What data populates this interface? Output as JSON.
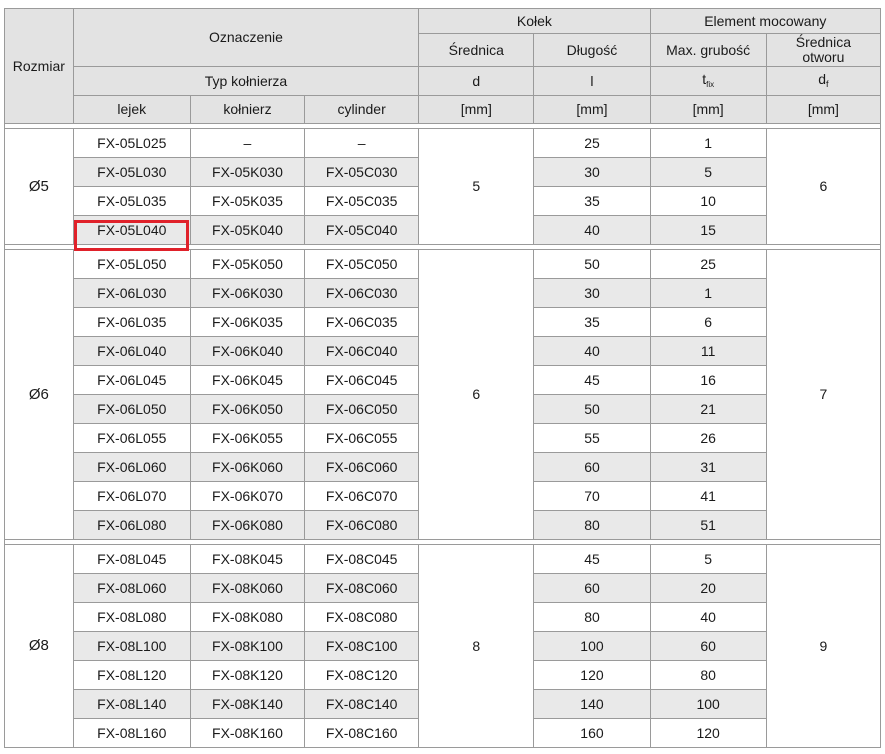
{
  "header": {
    "rozmiar": "Rozmiar",
    "oznaczenie": "Oznaczenie",
    "kolek": "Kołek",
    "element": "Element mocowany",
    "srednica": "Średnica",
    "dlugosc": "Długość",
    "max_grubosc": "Max. grubość",
    "srednica_otworu_1": "Średnica",
    "srednica_otworu_2": "otworu",
    "typ_kolnierza": "Typ kołnierza",
    "sym_d": "d",
    "sym_l": "l",
    "sym_t": "t",
    "sym_t_sub": "fix",
    "sym_df": "d",
    "sym_df_sub": "f",
    "col_lejek": "lejek",
    "col_kolnierz": "kołnierz",
    "col_cylinder": "cylinder",
    "unit_mm": "[mm]"
  },
  "groups": [
    {
      "size": "Ø5",
      "d": "5",
      "df": "6",
      "rows": [
        {
          "l": "FX-05L025",
          "k": "–",
          "c": "–",
          "len": "25",
          "t": "1"
        },
        {
          "l": "FX-05L030",
          "k": "FX-05K030",
          "c": "FX-05C030",
          "len": "30",
          "t": "5"
        },
        {
          "l": "FX-05L035",
          "k": "FX-05K035",
          "c": "FX-05C035",
          "len": "35",
          "t": "10"
        },
        {
          "l": "FX-05L040",
          "k": "FX-05K040",
          "c": "FX-05C040",
          "len": "40",
          "t": "15"
        }
      ]
    },
    {
      "size": "Ø6",
      "d": "6",
      "df": "7",
      "rows": [
        {
          "l": "FX-05L050",
          "k": "FX-05K050",
          "c": "FX-05C050",
          "len": "50",
          "t": "25"
        },
        {
          "l": "FX-06L030",
          "k": "FX-06K030",
          "c": "FX-06C030",
          "len": "30",
          "t": "1"
        },
        {
          "l": "FX-06L035",
          "k": "FX-06K035",
          "c": "FX-06C035",
          "len": "35",
          "t": "6"
        },
        {
          "l": "FX-06L040",
          "k": "FX-06K040",
          "c": "FX-06C040",
          "len": "40",
          "t": "11"
        },
        {
          "l": "FX-06L045",
          "k": "FX-06K045",
          "c": "FX-06C045",
          "len": "45",
          "t": "16"
        },
        {
          "l": "FX-06L050",
          "k": "FX-06K050",
          "c": "FX-06C050",
          "len": "50",
          "t": "21"
        },
        {
          "l": "FX-06L055",
          "k": "FX-06K055",
          "c": "FX-06C055",
          "len": "55",
          "t": "26"
        },
        {
          "l": "FX-06L060",
          "k": "FX-06K060",
          "c": "FX-06C060",
          "len": "60",
          "t": "31"
        },
        {
          "l": "FX-06L070",
          "k": "FX-06K070",
          "c": "FX-06C070",
          "len": "70",
          "t": "41"
        },
        {
          "l": "FX-06L080",
          "k": "FX-06K080",
          "c": "FX-06C080",
          "len": "80",
          "t": "51"
        }
      ]
    },
    {
      "size": "Ø8",
      "d": "8",
      "df": "9",
      "rows": [
        {
          "l": "FX-08L045",
          "k": "FX-08K045",
          "c": "FX-08C045",
          "len": "45",
          "t": "5"
        },
        {
          "l": "FX-08L060",
          "k": "FX-08K060",
          "c": "FX-08C060",
          "len": "60",
          "t": "20"
        },
        {
          "l": "FX-08L080",
          "k": "FX-08K080",
          "c": "FX-08C080",
          "len": "80",
          "t": "40"
        },
        {
          "l": "FX-08L100",
          "k": "FX-08K100",
          "c": "FX-08C100",
          "len": "100",
          "t": "60"
        },
        {
          "l": "FX-08L120",
          "k": "FX-08K120",
          "c": "FX-08C120",
          "len": "120",
          "t": "80"
        },
        {
          "l": "FX-08L140",
          "k": "FX-08K140",
          "c": "FX-08C140",
          "len": "140",
          "t": "100"
        },
        {
          "l": "FX-08L160",
          "k": "FX-08K160",
          "c": "FX-08C160",
          "len": "160",
          "t": "120"
        }
      ]
    }
  ],
  "colors": {
    "header_bg": "#e3e3e3",
    "stripe_bg": "#e9e9e9",
    "highlight": "#e0212a"
  }
}
